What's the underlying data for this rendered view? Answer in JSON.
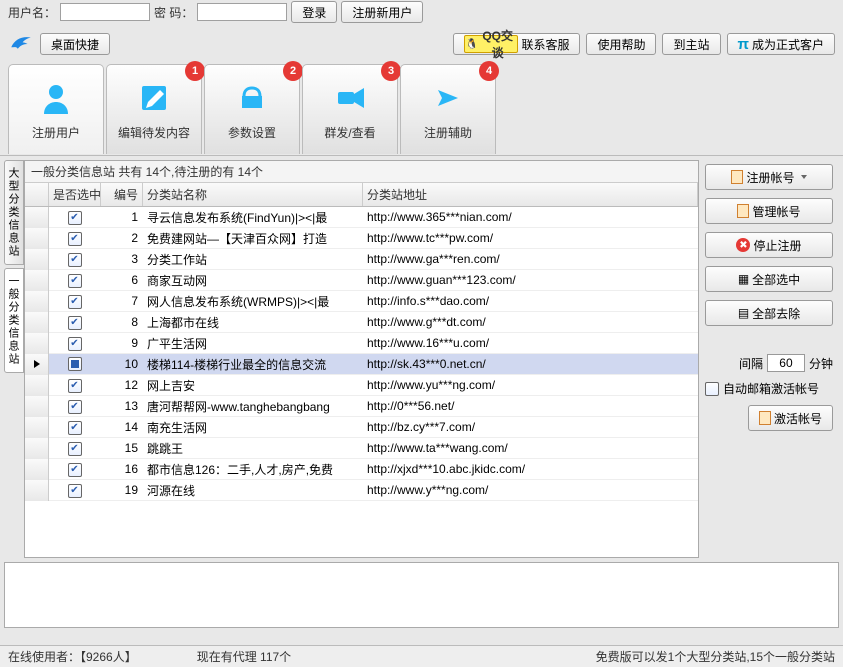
{
  "login": {
    "user_label": "用户名：",
    "pass_label": "密  码：",
    "login_btn": "登录",
    "register_btn": "注册新用户"
  },
  "toolbar": {
    "desktop_shortcut": "桌面快捷",
    "qq_text": "QQ交谈",
    "contact_cs": "联系客服",
    "help": "使用帮助",
    "to_main": "到主站",
    "become_member": "成为正式客户"
  },
  "nav": [
    {
      "label": "注册用户",
      "badge": null
    },
    {
      "label": "编辑待发内容",
      "badge": "1"
    },
    {
      "label": "参数设置",
      "badge": "2"
    },
    {
      "label": "群发/查看",
      "badge": "3"
    },
    {
      "label": "注册辅助",
      "badge": "4"
    }
  ],
  "vtabs": {
    "large": "大型分类信息站",
    "normal": "一般分类信息站"
  },
  "grid": {
    "title": "一般分类信息站 共有 14个,待注册的有 14个",
    "headers": {
      "chk": "是否选中",
      "id": "编号",
      "name": "分类站名称",
      "url": "分类站地址"
    },
    "rows": [
      {
        "chk": true,
        "id": 1,
        "name": "寻云信息发布系统(FindYun)|><|最",
        "url": "http://www.365***nian.com/"
      },
      {
        "chk": true,
        "id": 2,
        "name": "免费建网站—【天津百众网】打造",
        "url": "http://www.tc***pw.com/"
      },
      {
        "chk": true,
        "id": 3,
        "name": "分类工作站",
        "url": "http://www.ga***ren.com/"
      },
      {
        "chk": true,
        "id": 6,
        "name": "商家互动网",
        "url": "http://www.guan***123.com/"
      },
      {
        "chk": true,
        "id": 7,
        "name": "网人信息发布系统(WRMPS)|><|最",
        "url": "http://info.s***dao.com/"
      },
      {
        "chk": true,
        "id": 8,
        "name": "上海都市在线",
        "url": "http://www.g***dt.com/"
      },
      {
        "chk": true,
        "id": 9,
        "name": "广平生活网",
        "url": "http://www.16***u.com/"
      },
      {
        "chk": "half",
        "id": 10,
        "name": "楼梯114-楼梯行业最全的信息交流",
        "url": "http://sk.43***0.net.cn/",
        "sel": true
      },
      {
        "chk": true,
        "id": 12,
        "name": "网上吉安",
        "url": "http://www.yu***ng.com/"
      },
      {
        "chk": true,
        "id": 13,
        "name": "唐河帮帮网-www.tanghebangbang",
        "url": "http://0***56.net/"
      },
      {
        "chk": true,
        "id": 14,
        "name": "南充生活网",
        "url": "http://bz.cy***7.com/"
      },
      {
        "chk": true,
        "id": 15,
        "name": "跳跳王",
        "url": "http://www.ta***wang.com/"
      },
      {
        "chk": true,
        "id": 16,
        "name": "都市信息126：二手,人才,房产,免费",
        "url": "http://xjxd***10.abc.jkidc.com/"
      },
      {
        "chk": true,
        "id": 19,
        "name": "河源在线",
        "url": "http://www.y***ng.com/"
      }
    ]
  },
  "side": {
    "register_acct": "注册帐号",
    "manage_acct": "管理帐号",
    "stop_register": "停止注册",
    "select_all": "全部选中",
    "remove_all": "全部去除",
    "interval_label_l": "间隔",
    "interval_value": "60",
    "interval_label_r": "分钟",
    "auto_activate": "自动邮箱激活帐号",
    "activate_acct": "激活帐号"
  },
  "status": {
    "online": "在线使用者：【9266人】",
    "agents": "现在有代理 117个",
    "free_info": "免费版可以发1个大型分类站,15个一般分类站"
  }
}
